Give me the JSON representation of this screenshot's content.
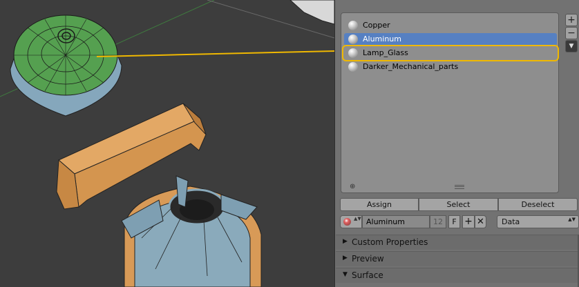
{
  "materials": [
    {
      "name": "Copper",
      "selected": false,
      "highlighted": false
    },
    {
      "name": "Aluminum",
      "selected": true,
      "highlighted": false
    },
    {
      "name": "Lamp_Glass",
      "selected": false,
      "highlighted": true
    },
    {
      "name": "Darker_Mechanical_parts",
      "selected": false,
      "highlighted": false
    }
  ],
  "list_controls": {
    "add_slot": "+",
    "remove_slot": "−",
    "specials": "▼",
    "add_small": "⊕"
  },
  "buttons": {
    "assign": "Assign",
    "select": "Select",
    "deselect": "Deselect"
  },
  "material_slot": {
    "name": "Aluminum",
    "users": "12",
    "fake_user": "F",
    "new": "+",
    "unlink": "✕",
    "link": "Data",
    "arrows": "▲▼"
  },
  "sections": [
    {
      "label": "Custom Properties",
      "arrow": "▶"
    },
    {
      "label": "Preview",
      "arrow": "▶"
    },
    {
      "label": "Surface",
      "arrow": "▼"
    }
  ],
  "colors": {
    "highlight": "#f0b800",
    "selected": "#5680c2",
    "panel": "#727272",
    "viewport": "#3d3d3d"
  },
  "callout_target": "Lamp_Glass"
}
